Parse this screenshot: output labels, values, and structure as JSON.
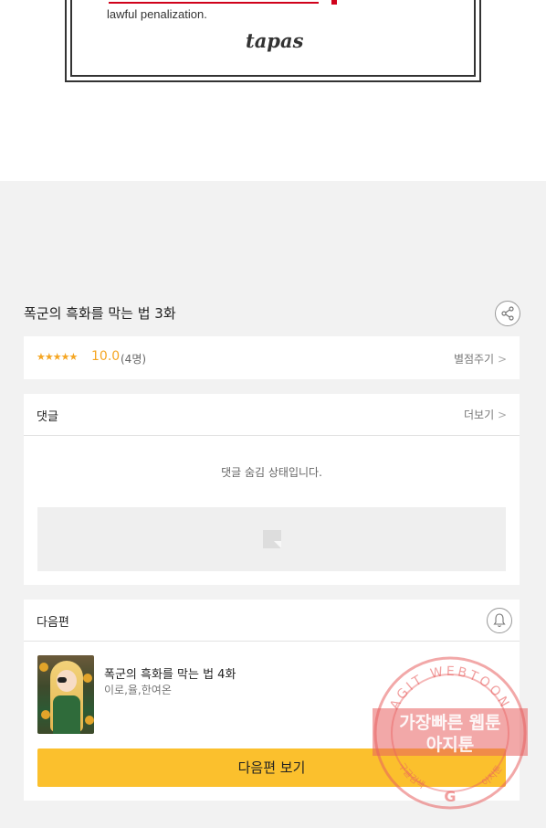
{
  "comic_panel": {
    "disclaimer_text": "lawful penalization.",
    "publisher_logo": "tapas"
  },
  "episode": {
    "title": "폭군의 흑화를 막는 법 3화",
    "share_icon": "share-icon"
  },
  "rating": {
    "stars": "★★★★★",
    "score": "10.0",
    "count": "(4명)",
    "rate_link": "별점주기",
    "chevron": ">"
  },
  "comments": {
    "label": "댓글",
    "more_link": "더보기",
    "chevron": ">",
    "hidden_message": "댓글 숨김 상태입니다."
  },
  "next_episode": {
    "label": "다음편",
    "bell_icon": "bell-icon",
    "title": "폭군의 흑화를 막는 법 4화",
    "authors": "이로,율,한여온",
    "button_label": "다음편 보기"
  },
  "watermark": {
    "arc_text": "AGIT WEBTOON",
    "line1": "가장빠른 웹툰",
    "line2": "아지툰",
    "bottom_left": "구글검색",
    "bottom_right": "아지툰",
    "logo_letter": "G"
  },
  "colors": {
    "accent_yellow": "#fbc02d",
    "star_orange": "#f5a623",
    "background_gray": "#f2f2f2",
    "stamp_red": "#e86060"
  }
}
